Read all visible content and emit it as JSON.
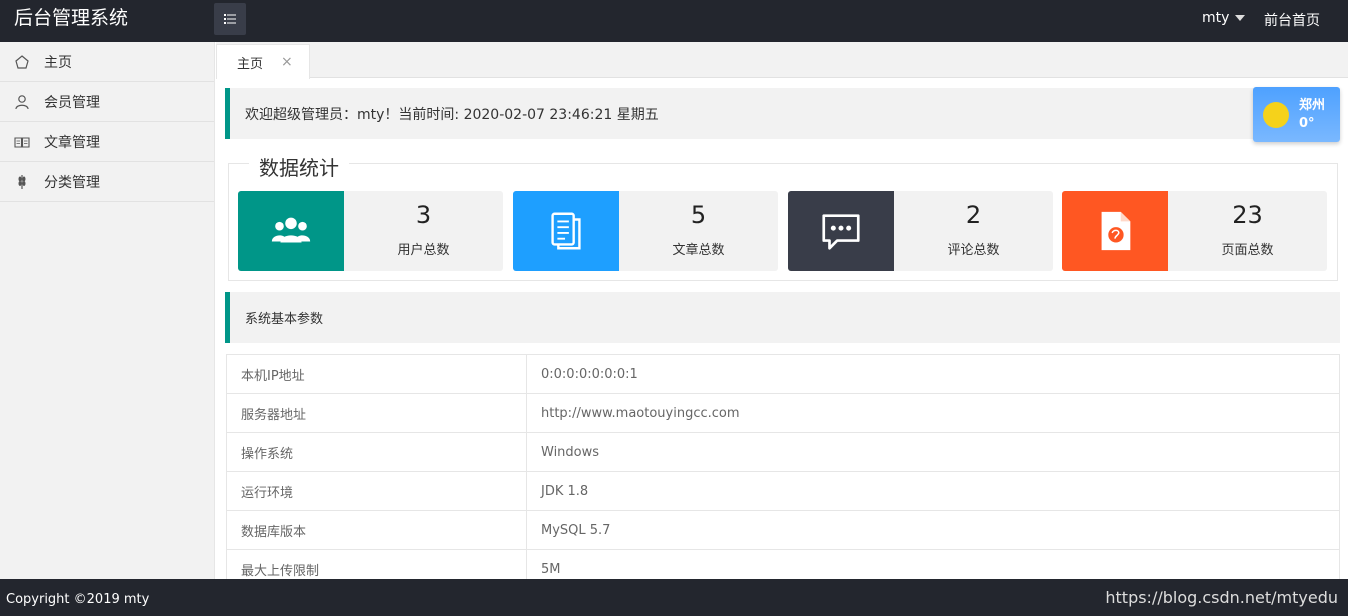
{
  "header": {
    "logo": "后台管理系统",
    "user": "mty",
    "front_link": "前台首页"
  },
  "sidebar": {
    "items": [
      {
        "label": "主页",
        "icon": "home-icon"
      },
      {
        "label": "会员管理",
        "icon": "user-icon"
      },
      {
        "label": "文章管理",
        "icon": "book-icon"
      },
      {
        "label": "分类管理",
        "icon": "wheat-icon"
      }
    ]
  },
  "tabs": [
    {
      "label": "主页",
      "close": "×"
    }
  ],
  "welcome": "欢迎超级管理员：mty！当前时间: 2020-02-07 23:46:21 星期五",
  "weather": {
    "city": "郑州",
    "temp": "0°"
  },
  "stats": {
    "title": "数据统计",
    "cards": [
      {
        "value": "3",
        "label": "用户总数",
        "color": "#009688",
        "icon": "users-icon"
      },
      {
        "value": "5",
        "label": "文章总数",
        "color": "#1e9fff",
        "icon": "document-icon"
      },
      {
        "value": "2",
        "label": "评论总数",
        "color": "#393d49",
        "icon": "comment-icon"
      },
      {
        "value": "23",
        "label": "页面总数",
        "color": "#ff5722",
        "icon": "page-icon"
      }
    ]
  },
  "system": {
    "title": "系统基本参数",
    "rows": [
      {
        "key": "本机IP地址",
        "value": "0:0:0:0:0:0:0:1"
      },
      {
        "key": "服务器地址",
        "value": "http://www.maotouyingcc.com"
      },
      {
        "key": "操作系统",
        "value": "Windows"
      },
      {
        "key": "运行环境",
        "value": "JDK 1.8"
      },
      {
        "key": "数据库版本",
        "value": "MySQL 5.7"
      },
      {
        "key": "最大上传限制",
        "value": "5M"
      }
    ]
  },
  "footer": {
    "copyright": "Copyright ©2019 mty",
    "watermark": "https://blog.csdn.net/mtyedu"
  }
}
